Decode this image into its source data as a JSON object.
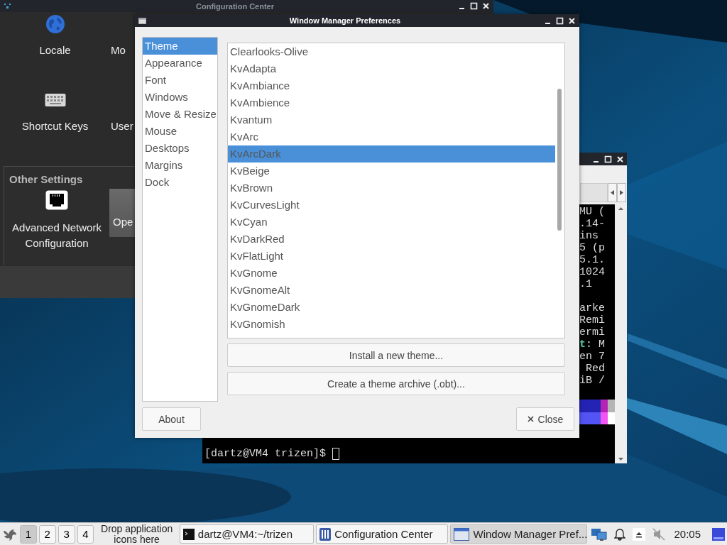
{
  "config_center": {
    "title": "Configuration Center",
    "items": [
      {
        "label": "Locale",
        "kind": "globe"
      },
      {
        "label": "Mo",
        "kind": "hidden"
      },
      {
        "label": "Shortcut Keys",
        "kind": "keyboard"
      },
      {
        "label": "User",
        "kind": "hidden"
      }
    ],
    "other_settings": {
      "heading": "Other Settings",
      "items": [
        {
          "label": "Advanced Network Configuration",
          "kind": "network",
          "selected": false
        },
        {
          "label": "Ope",
          "kind": "hidden",
          "selected": true
        }
      ]
    }
  },
  "terminal": {
    "blocks": [
      [
        "MU (",
        ".14-",
        "ins",
        "5 (p",
        "5.1.",
        "1024",
        ".1"
      ],
      [
        "arke",
        "Remi",
        "ermi",
        "**t**: M",
        "en 7",
        " Red",
        "iB /"
      ]
    ],
    "prompt": "[dartz@VM4 trizen]$"
  },
  "wm_preferences": {
    "title": "Window Manager Preferences",
    "sections": [
      {
        "label": "Theme",
        "selected": true
      },
      {
        "label": "Appearance",
        "selected": false
      },
      {
        "label": "Font",
        "selected": false
      },
      {
        "label": "Windows",
        "selected": false
      },
      {
        "label": "Move & Resize",
        "selected": false
      },
      {
        "label": "Mouse",
        "selected": false
      },
      {
        "label": "Desktops",
        "selected": false
      },
      {
        "label": "Margins",
        "selected": false
      },
      {
        "label": "Dock",
        "selected": false
      }
    ],
    "themes": [
      {
        "name": "Clearlooks-Olive",
        "selected": false
      },
      {
        "name": "KvAdapta",
        "selected": false
      },
      {
        "name": "KvAmbiance",
        "selected": false
      },
      {
        "name": "KvAmbience",
        "selected": false
      },
      {
        "name": "Kvantum",
        "selected": false
      },
      {
        "name": "KvArc",
        "selected": false
      },
      {
        "name": "KvArcDark",
        "selected": true
      },
      {
        "name": "KvBeige",
        "selected": false
      },
      {
        "name": "KvBrown",
        "selected": false
      },
      {
        "name": "KvCurvesLight",
        "selected": false
      },
      {
        "name": "KvCyan",
        "selected": false
      },
      {
        "name": "KvDarkRed",
        "selected": false
      },
      {
        "name": "KvFlatLight",
        "selected": false
      },
      {
        "name": "KvGnome",
        "selected": false
      },
      {
        "name": "KvGnomeAlt",
        "selected": false
      },
      {
        "name": "KvGnomeDark",
        "selected": false
      },
      {
        "name": "KvGnomish",
        "selected": false
      }
    ],
    "install_button": "Install a new theme...",
    "archive_button": "Create a theme archive (.obt)...",
    "about_button": "About",
    "close_button": "Close"
  },
  "taskbar": {
    "workspaces": [
      {
        "label": "1",
        "selected": true
      },
      {
        "label": "2",
        "selected": false
      },
      {
        "label": "3",
        "selected": false
      },
      {
        "label": "4",
        "selected": false
      }
    ],
    "launcher_hint": "Drop application icons here",
    "tasks": [
      {
        "label": "dartz@VM4:~/trizen",
        "kind": "terminal",
        "selected": false
      },
      {
        "label": "Configuration Center",
        "kind": "config",
        "selected": false
      },
      {
        "label": "Window Manager Pref...",
        "kind": "window",
        "selected": true
      }
    ],
    "clock": "20:05"
  }
}
